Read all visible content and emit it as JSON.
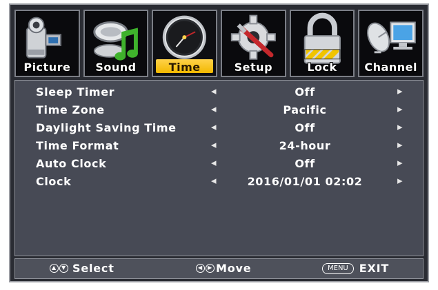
{
  "tabs": [
    {
      "label": "Picture",
      "icon": "camcorder-icon",
      "active": false
    },
    {
      "label": "Sound",
      "icon": "music-note-icon",
      "active": false
    },
    {
      "label": "Time",
      "icon": "clock-icon",
      "active": true
    },
    {
      "label": "Setup",
      "icon": "gear-wrench-icon",
      "active": false
    },
    {
      "label": "Lock",
      "icon": "padlock-icon",
      "active": false
    },
    {
      "label": "Channel",
      "icon": "satellite-dish-icon",
      "active": false
    }
  ],
  "settings": [
    {
      "name": "Sleep Timer",
      "value": "Off"
    },
    {
      "name": "Time Zone",
      "value": "Pacific"
    },
    {
      "name": "Daylight Saving Time",
      "value": "Off"
    },
    {
      "name": "Time Format",
      "value": "24-hour"
    },
    {
      "name": "Auto Clock",
      "value": "Off"
    },
    {
      "name": "Clock",
      "value": "2016/01/01 02:02"
    }
  ],
  "footer": {
    "select_label": "Select",
    "move_label": "Move",
    "menu_key": "MENU",
    "exit_label": "EXIT"
  },
  "colors": {
    "active_tab_highlight": "#f2b800",
    "panel_bg": "#474a55",
    "frame_bg": "#2a2c33"
  }
}
